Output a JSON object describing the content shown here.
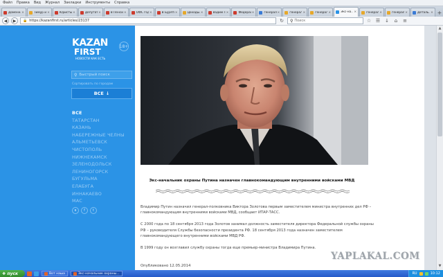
{
  "browser": {
    "menu": [
      "Файл",
      "Правка",
      "Вид",
      "Журнал",
      "Закладки",
      "Инструменты",
      "Справка"
    ],
    "tabs": [
      {
        "label": "Доменна...",
        "color": "#cc3b2e"
      },
      {
        "label": "Тимур и...",
        "color": "#e6a82c"
      },
      {
        "label": "Юристы...",
        "color": "#cc3b2e"
      },
      {
        "label": "Депутат...",
        "color": "#cc3b2e"
      },
      {
        "label": "В Пенсия...",
        "color": "#cc3b2e"
      },
      {
        "label": "ОФС год...",
        "color": "#cc3b2e"
      },
      {
        "label": "В Бурятии",
        "color": "#cc3b2e"
      },
      {
        "label": "Доходы...",
        "color": "#e6a82c"
      },
      {
        "label": "Вадим П...",
        "color": "#cc3b2e"
      },
      {
        "label": "Федерал...",
        "color": "#cc3b2e"
      },
      {
        "label": "генералы...",
        "color": "#3a7bd5"
      },
      {
        "label": "генералы",
        "color": "#e6a82c"
      },
      {
        "label": "генералы",
        "color": "#e6a82c"
      },
      {
        "label": "Экс-на...",
        "color": "#2b93e6",
        "active": true
      },
      {
        "label": "генералы",
        "color": "#e6a82c"
      },
      {
        "label": "генералы...",
        "color": "#e6a82c"
      },
      {
        "label": "Деталь...",
        "color": "#3a7bd5"
      }
    ],
    "url": "https://kazanfirst.ru/articles/23137",
    "search_placeholder": "Поиск"
  },
  "sidebar": {
    "logo_top": "KAZAN",
    "logo_bottom": "FIRST",
    "logo_tagline": "НОВОСТИ КАК ЕСТЬ",
    "age_badge": "18+",
    "search_placeholder": "Быстрый поиск",
    "search_hint": "Сортировать по городам",
    "all_button": "ВСЕ",
    "cities": [
      {
        "label": "ВСЕ",
        "active": true
      },
      {
        "label": "ТАТАРСТАН"
      },
      {
        "label": "КАЗАНЬ"
      },
      {
        "label": "НАБЕРЕЖНЫЕ ЧЕЛНЫ"
      },
      {
        "label": "АЛЬМЕТЬЕВСК"
      },
      {
        "label": "ЧИСТОПОЛЬ"
      },
      {
        "label": "НИЖНЕКАМСК"
      },
      {
        "label": "ЗЕЛЕНОДОЛЬСК"
      },
      {
        "label": "ЛЕНИНОГОРСК"
      },
      {
        "label": "БУГУЛЬМА"
      },
      {
        "label": "ЕЛАБУГА"
      },
      {
        "label": "ИННАКАЕВО"
      },
      {
        "label": "МАС"
      }
    ]
  },
  "article": {
    "headline": "Экс-начальник охраны Путина назначен главнокомандующим внутренними войсками МВД",
    "paragraphs": [
      "Владимир Путин назначил генерал-полковника Виктора Золотова первым заместителем министра внутренних дел РФ – главнокомандующим внутренними войсками МВД, сообщает ИТАР-ТАСС.",
      "С 2000 года по 18 сентября 2013 года Золотов занимал должность заместителя директора Федеральной службы охраны РФ – руководителя Службы безопасности президента РФ. 18 сентября 2013 года назначен заместителем главнокомандующего внутренними войсками МВД РФ.",
      "В 1999 году он возглавил службу охраны тогда еще премьер-министра Владимира Путина."
    ],
    "published": "Опубликовано 12.05.2014"
  },
  "watermark": "YAPLAKAL.COM",
  "taskbar": {
    "start_label": "пуск",
    "tasks": [
      {
        "label": "Вот наша",
        "active": false
      },
      {
        "label": "Экс-начальник охраны...",
        "active": true
      }
    ],
    "lang": "RU",
    "clock": "10:12"
  }
}
